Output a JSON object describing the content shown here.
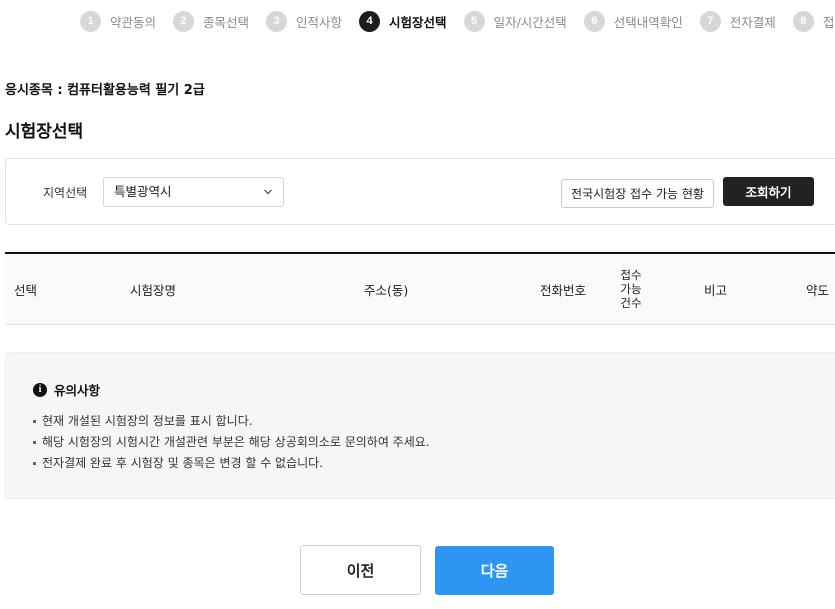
{
  "steps": [
    {
      "num": "1",
      "label": "약관동의",
      "active": false
    },
    {
      "num": "2",
      "label": "종목선택",
      "active": false
    },
    {
      "num": "3",
      "label": "인적사항",
      "active": false
    },
    {
      "num": "4",
      "label": "시험장선택",
      "active": true
    },
    {
      "num": "5",
      "label": "일자/시간선택",
      "active": false
    },
    {
      "num": "6",
      "label": "선택내역확인",
      "active": false
    },
    {
      "num": "7",
      "label": "전자결제",
      "active": false
    },
    {
      "num": "8",
      "label": "접수확",
      "active": false
    }
  ],
  "subject_line": "응시종목 : 컴퓨터활용능력 필기 2급",
  "section_title": "시험장선택",
  "search": {
    "region_label": "지역선택",
    "region_selected": "특별광역시",
    "status_button": "전국시험장 접수 가능 현황",
    "query_button": "조회하기"
  },
  "table": {
    "headers": {
      "select": "선택",
      "name": "시험장명",
      "address": "주소(동)",
      "phone": "전화번호",
      "available": [
        "접수",
        "가능",
        "건수"
      ],
      "note": "비고",
      "map": "약도"
    },
    "rows": []
  },
  "notice": {
    "title": "유의사항",
    "items": [
      "현재 개설된 시험장의 정보를 표시 합니다.",
      "해당 시험장의 시험시간 개설관련 부분은 해당 상공회의소로 문의하여 주세요.",
      "전자결제 완료 후 시험장 및 종목은 변경 할 수 없습니다."
    ]
  },
  "buttons": {
    "prev": "이전",
    "next": "다음"
  },
  "colors": {
    "primary": "#2c96f2",
    "dark": "#222222",
    "step_inactive": "#d7d7d7",
    "notice_bg": "#f5f6f8"
  }
}
